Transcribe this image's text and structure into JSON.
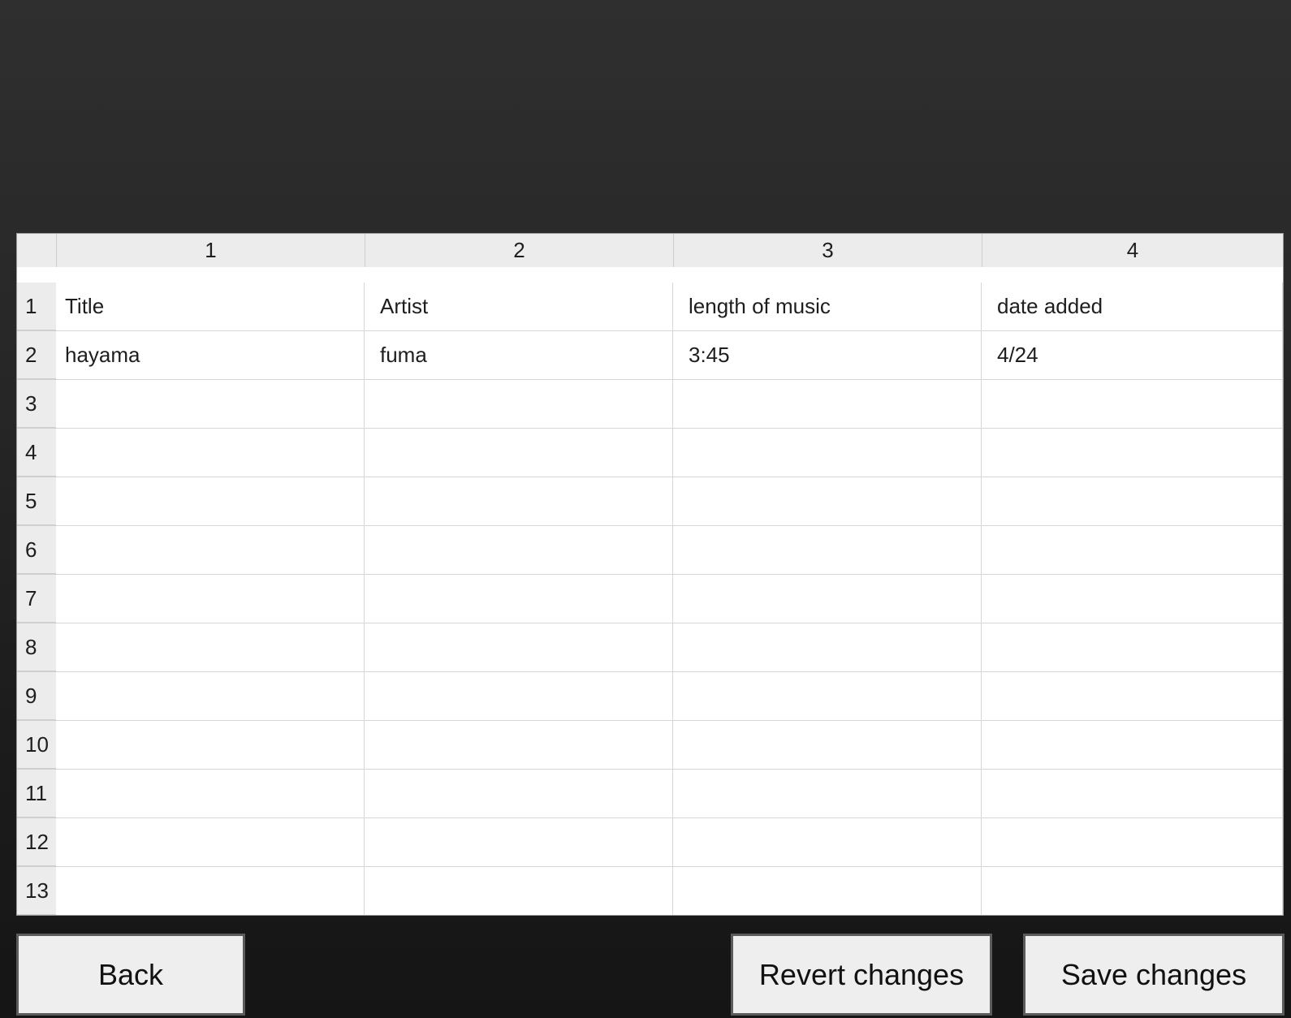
{
  "table": {
    "column_headers": [
      "1",
      "2",
      "3",
      "4"
    ],
    "row_headers": [
      "1",
      "2",
      "3",
      "4",
      "5",
      "6",
      "7",
      "8",
      "9",
      "10",
      "11",
      "12",
      "13",
      ""
    ],
    "rows": [
      [
        "Title",
        "Artist",
        "length of music",
        "date added"
      ],
      [
        "hayama",
        "fuma",
        "3:45",
        "4/24"
      ],
      [
        "",
        "",
        "",
        ""
      ],
      [
        "",
        "",
        "",
        ""
      ],
      [
        "",
        "",
        "",
        ""
      ],
      [
        "",
        "",
        "",
        ""
      ],
      [
        "",
        "",
        "",
        ""
      ],
      [
        "",
        "",
        "",
        ""
      ],
      [
        "",
        "",
        "",
        ""
      ],
      [
        "",
        "",
        "",
        ""
      ],
      [
        "",
        "",
        "",
        ""
      ],
      [
        "",
        "",
        "",
        ""
      ],
      [
        "",
        "",
        "",
        ""
      ],
      [
        "",
        "",
        "",
        ""
      ]
    ]
  },
  "buttons": {
    "back": "Back",
    "revert": "Revert changes",
    "save": "Save changes"
  }
}
